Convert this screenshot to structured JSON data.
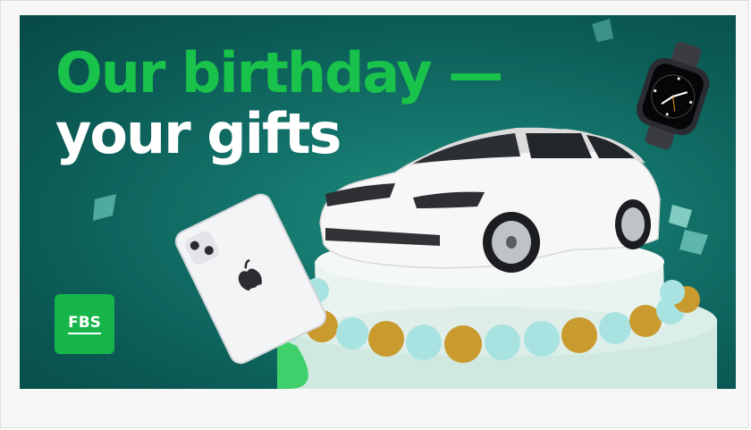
{
  "promo": {
    "headline_line1": "Our birthday —",
    "headline_line2": "your gifts",
    "logo_text": "FBS"
  },
  "colors": {
    "brand_green": "#19c24a",
    "banner_teal": "#13736a",
    "logo_bg": "#15b54a"
  }
}
